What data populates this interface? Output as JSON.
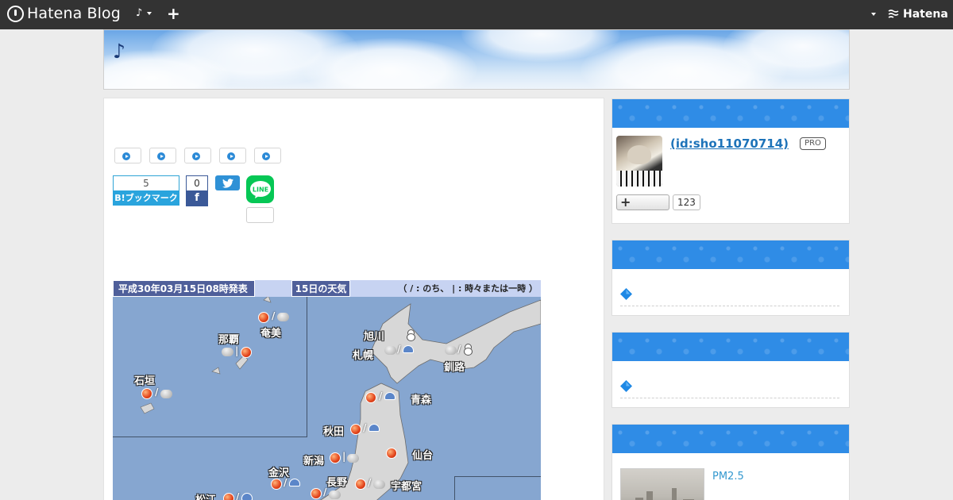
{
  "topbar": {
    "brand": "Hatena Blog",
    "blog_menu": "♪",
    "add": "+",
    "logo": "Hatena"
  },
  "blog": {
    "title": "♪"
  },
  "share": {
    "hatebu_count": "5",
    "hatebu_label": "B!ブックマーク",
    "fb_count": "0",
    "fb_label": "f",
    "line_label": "LINE"
  },
  "weather_map": {
    "issued": "平成30年03月15日08時発表",
    "day": "15日の天気",
    "legend": "（ / : のち、 | : 時々または一時 ）",
    "cities": [
      "奄美",
      "那覇",
      "石垣",
      "旭川",
      "札幌",
      "釧路",
      "青森",
      "秋田",
      "仙台",
      "新潟",
      "金沢",
      "長野",
      "宇都宮",
      "松江"
    ],
    "sep_slash": "/",
    "sep_bar": "|"
  },
  "sidebar": {
    "profile": {
      "id": " (id:sho11070714)",
      "pro": "PRO",
      "follow": "+",
      "count": "123"
    },
    "pm": {
      "label": "PM2.5"
    }
  },
  "icons": {
    "brand": "hatena-blog-icon",
    "play": "play-icon",
    "twitter": "twitter-bird-icon",
    "line": "line-icon",
    "diamond": "blue-diamond-icon"
  },
  "colors": {
    "topbar": "#333333",
    "accent_blue": "#2f8ce6",
    "hatebu": "#2aa4dd",
    "facebook": "#3b5998",
    "line": "#06c755"
  }
}
